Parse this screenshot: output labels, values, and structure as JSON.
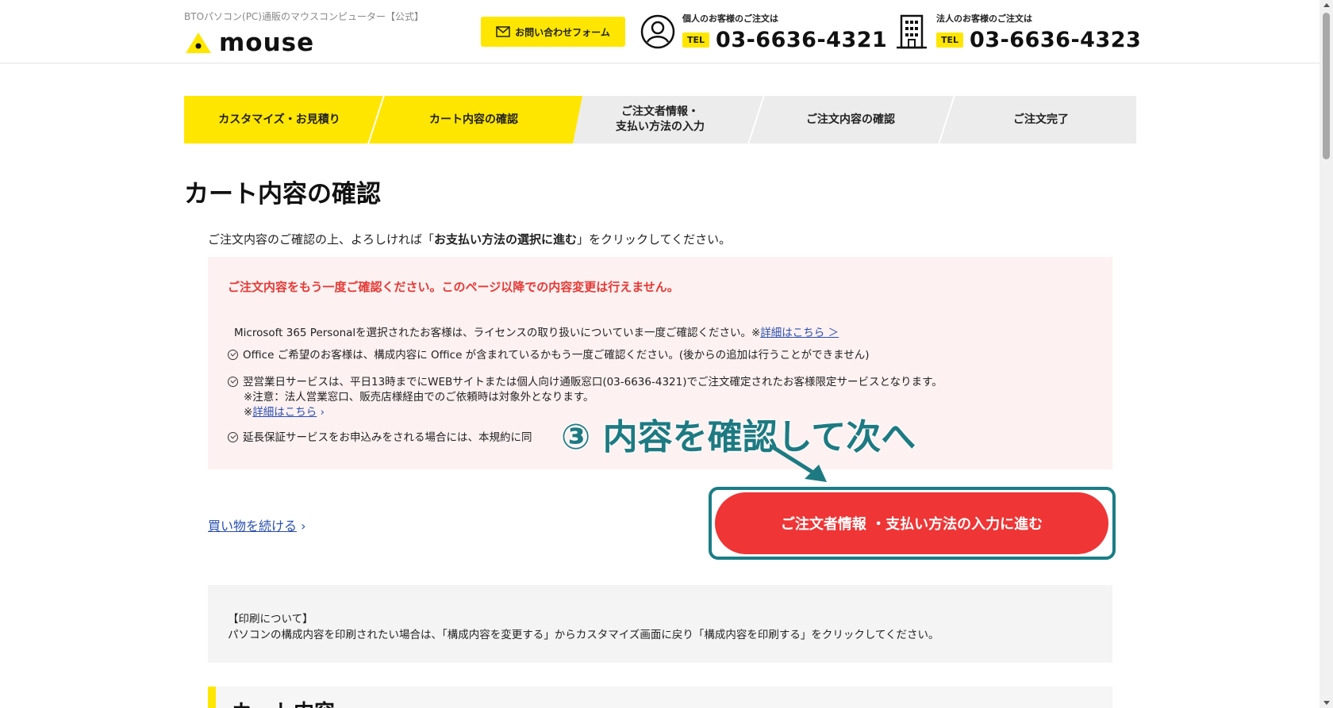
{
  "header": {
    "tagline": "BTOパソコン(PC)通販のマウスコンピューター【公式】",
    "logo_text": "mouse",
    "contact_button": "お問い合わせフォーム",
    "personal": {
      "caption": "個人のお客様のご注文は",
      "tel_label": "TEL",
      "number": "03-6636-4321"
    },
    "corporate": {
      "caption": "法人のお客様のご注文は",
      "tel_label": "TEL",
      "number": "03-6636-4323"
    }
  },
  "steps": [
    {
      "label": "カスタマイズ・お見積り",
      "active": true
    },
    {
      "label": "カート内容の確認",
      "active": true
    },
    {
      "label_line1": "ご注文者情報・",
      "label_line2": "支払い方法の入力",
      "active": false
    },
    {
      "label": "ご注文内容の確認",
      "active": false
    },
    {
      "label": "ご注文完了",
      "active": false
    }
  ],
  "page_title": "カート内容の確認",
  "intro": {
    "before": "ご注文内容のご確認の上、よろしければ「",
    "bold": "お支払い方法の選択に進む",
    "after": "」をクリックしてください。"
  },
  "notice": {
    "heading": "ご注文内容をもう一度ご確認ください。このページ以降での内容変更は行えません。",
    "ms365": "Microsoft 365 Personalを選択されたお客様は、ライセンスの取り扱いについていま一度ご確認ください。※",
    "ms365_link": "詳細はこちら ＞",
    "office": "Office ご希望のお客様は、構成内容に Office が含まれているかもう一度ご確認ください。(後からの追加は行うことができません)",
    "nextday": "翌営業日サービスは、平日13時までにWEBサイトまたは個人向け通販窓口(03-6636-4321)でご注文確定されたお客様限定サービスとなります。",
    "nextday_note": "※注意：法人営業窓口、販売店様経由でのご依頼時は対象外となります。",
    "nextday_link_prefix": "※",
    "nextday_link": "詳細はこちら",
    "warranty": "延長保証サービスをお申込みをされる場合には、本規約に同"
  },
  "annotation": "③ 内容を確認して次へ",
  "continue_link": "買い物を続ける",
  "cta_button": "ご注文者情報 ・支払い方法の入力に進む",
  "print": {
    "title": "【印刷について】",
    "body": "パソコンの構成内容を印刷されたい場合は、「構成内容を変更する」からカスタマイズ画面に戻り「構成内容を印刷する」をクリックしてください。"
  },
  "bottom_heading": "カート内容",
  "colors": {
    "accent_yellow": "#ffe600",
    "cta_red": "#ef3535",
    "annotation_teal": "#1b7d86",
    "warning_red": "#e53935"
  }
}
